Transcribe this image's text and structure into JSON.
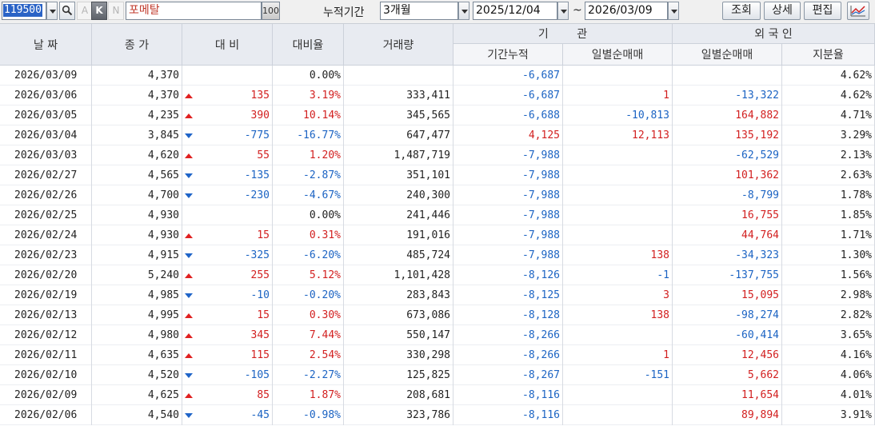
{
  "toolbar": {
    "code": "119500",
    "letter_a": "A",
    "letter_k": "K",
    "letter_n": "N",
    "stock_name": "포메탈",
    "percent_label": "100",
    "period_label": "누적기간",
    "period_value": "3개월",
    "start_date": "2025/12/04",
    "tilde": "~",
    "end_date": "2026/03/09",
    "search_button": "조회",
    "detail_button": "상세",
    "edit_button": "편집"
  },
  "header": {
    "date": "날 짜",
    "close": "종 가",
    "change": "대 비",
    "change_rate": "대비율",
    "volume": "거래량",
    "institution": "기        관",
    "inst_cumulative": "기간누적",
    "inst_daily": "일별순매매",
    "foreign": "외 국 인",
    "foreign_daily": "일별순매매",
    "foreign_share": "지분율"
  },
  "colors": {
    "up": "#d21f1f",
    "down": "#1b63c3",
    "header_bg": "#e8ebf1",
    "selection": "#2a63c6"
  },
  "rows": [
    {
      "date": "2026/03/09",
      "close": "4,370",
      "dir": "flat",
      "change": "",
      "rate": "0.00%",
      "volume": "",
      "inst_cum": "-6,687",
      "inst_daily": "",
      "frn_daily": "",
      "share": "4.62%"
    },
    {
      "date": "2026/03/06",
      "close": "4,370",
      "dir": "up",
      "change": "135",
      "rate": "3.19%",
      "volume": "333,411",
      "inst_cum": "-6,687",
      "inst_daily": "1",
      "frn_daily": "-13,322",
      "share": "4.62%"
    },
    {
      "date": "2026/03/05",
      "close": "4,235",
      "dir": "up",
      "change": "390",
      "rate": "10.14%",
      "volume": "345,565",
      "inst_cum": "-6,688",
      "inst_daily": "-10,813",
      "frn_daily": "164,882",
      "share": "4.71%"
    },
    {
      "date": "2026/03/04",
      "close": "3,845",
      "dir": "down",
      "change": "-775",
      "rate": "-16.77%",
      "volume": "647,477",
      "inst_cum": "4,125",
      "inst_daily": "12,113",
      "frn_daily": "135,192",
      "share": "3.29%"
    },
    {
      "date": "2026/03/03",
      "close": "4,620",
      "dir": "up",
      "change": "55",
      "rate": "1.20%",
      "volume": "1,487,719",
      "inst_cum": "-7,988",
      "inst_daily": "",
      "frn_daily": "-62,529",
      "share": "2.13%"
    },
    {
      "date": "2026/02/27",
      "close": "4,565",
      "dir": "down",
      "change": "-135",
      "rate": "-2.87%",
      "volume": "351,101",
      "inst_cum": "-7,988",
      "inst_daily": "",
      "frn_daily": "101,362",
      "share": "2.63%"
    },
    {
      "date": "2026/02/26",
      "close": "4,700",
      "dir": "down",
      "change": "-230",
      "rate": "-4.67%",
      "volume": "240,300",
      "inst_cum": "-7,988",
      "inst_daily": "",
      "frn_daily": "-8,799",
      "share": "1.78%"
    },
    {
      "date": "2026/02/25",
      "close": "4,930",
      "dir": "flat",
      "change": "",
      "rate": "0.00%",
      "volume": "241,446",
      "inst_cum": "-7,988",
      "inst_daily": "",
      "frn_daily": "16,755",
      "share": "1.85%"
    },
    {
      "date": "2026/02/24",
      "close": "4,930",
      "dir": "up",
      "change": "15",
      "rate": "0.31%",
      "volume": "191,016",
      "inst_cum": "-7,988",
      "inst_daily": "",
      "frn_daily": "44,764",
      "share": "1.71%"
    },
    {
      "date": "2026/02/23",
      "close": "4,915",
      "dir": "down",
      "change": "-325",
      "rate": "-6.20%",
      "volume": "485,724",
      "inst_cum": "-7,988",
      "inst_daily": "138",
      "frn_daily": "-34,323",
      "share": "1.30%"
    },
    {
      "date": "2026/02/20",
      "close": "5,240",
      "dir": "up",
      "change": "255",
      "rate": "5.12%",
      "volume": "1,101,428",
      "inst_cum": "-8,126",
      "inst_daily": "-1",
      "frn_daily": "-137,755",
      "share": "1.56%"
    },
    {
      "date": "2026/02/19",
      "close": "4,985",
      "dir": "down",
      "change": "-10",
      "rate": "-0.20%",
      "volume": "283,843",
      "inst_cum": "-8,125",
      "inst_daily": "3",
      "frn_daily": "15,095",
      "share": "2.98%"
    },
    {
      "date": "2026/02/13",
      "close": "4,995",
      "dir": "up",
      "change": "15",
      "rate": "0.30%",
      "volume": "673,086",
      "inst_cum": "-8,128",
      "inst_daily": "138",
      "frn_daily": "-98,274",
      "share": "2.82%"
    },
    {
      "date": "2026/02/12",
      "close": "4,980",
      "dir": "up",
      "change": "345",
      "rate": "7.44%",
      "volume": "550,147",
      "inst_cum": "-8,266",
      "inst_daily": "",
      "frn_daily": "-60,414",
      "share": "3.65%"
    },
    {
      "date": "2026/02/11",
      "close": "4,635",
      "dir": "up",
      "change": "115",
      "rate": "2.54%",
      "volume": "330,298",
      "inst_cum": "-8,266",
      "inst_daily": "1",
      "frn_daily": "12,456",
      "share": "4.16%"
    },
    {
      "date": "2026/02/10",
      "close": "4,520",
      "dir": "down",
      "change": "-105",
      "rate": "-2.27%",
      "volume": "125,825",
      "inst_cum": "-8,267",
      "inst_daily": "-151",
      "frn_daily": "5,662",
      "share": "4.06%"
    },
    {
      "date": "2026/02/09",
      "close": "4,625",
      "dir": "up",
      "change": "85",
      "rate": "1.87%",
      "volume": "208,681",
      "inst_cum": "-8,116",
      "inst_daily": "",
      "frn_daily": "11,654",
      "share": "4.01%"
    },
    {
      "date": "2026/02/06",
      "close": "4,540",
      "dir": "down",
      "change": "-45",
      "rate": "-0.98%",
      "volume": "323,786",
      "inst_cum": "-8,116",
      "inst_daily": "",
      "frn_daily": "89,894",
      "share": "3.91%"
    }
  ]
}
